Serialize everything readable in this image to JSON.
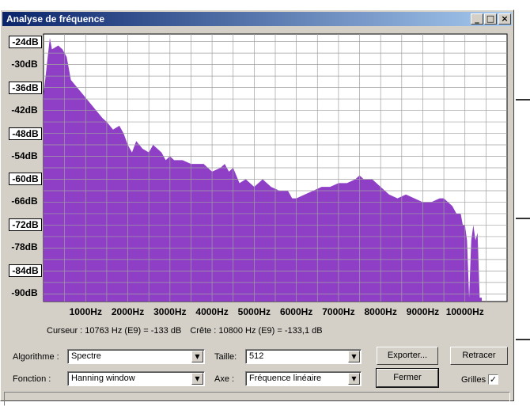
{
  "window": {
    "title": "Analyse de fréquence"
  },
  "titlebar_buttons": {
    "minimize": "_",
    "maximize": "□",
    "close": "×"
  },
  "chart_data": {
    "type": "area",
    "color": "#8e3fc6",
    "grid": true,
    "x_unit": "Hz",
    "y_unit": "dB",
    "xlim": [
      0,
      11000
    ],
    "ylim": [
      -92,
      -22
    ],
    "x_ticks": [
      "1000Hz",
      "2000Hz",
      "3000Hz",
      "4000Hz",
      "5000Hz",
      "6000Hz",
      "7000Hz",
      "8000Hz",
      "9000Hz",
      "10000Hz"
    ],
    "y_ticks": [
      "-24dB",
      "-30dB",
      "-36dB",
      "-42dB",
      "-48dB",
      "-54dB",
      "-60dB",
      "-66dB",
      "-72dB",
      "-78dB",
      "-84dB",
      "-90dB"
    ],
    "x": [
      0,
      150,
      200,
      350,
      450,
      550,
      650,
      800,
      950,
      1100,
      1250,
      1400,
      1500,
      1650,
      1800,
      1900,
      2000,
      2050,
      2100,
      2200,
      2350,
      2500,
      2600,
      2800,
      2900,
      3000,
      3100,
      3300,
      3500,
      3800,
      4000,
      4200,
      4300,
      4400,
      4500,
      4650,
      4800,
      5000,
      5200,
      5400,
      5600,
      5800,
      5900,
      6000,
      6200,
      6400,
      6600,
      6800,
      7000,
      7200,
      7400,
      7500,
      7600,
      7800,
      8000,
      8200,
      8400,
      8600,
      8800,
      9000,
      9200,
      9400,
      9500,
      9700,
      9800,
      9900,
      9950,
      10000,
      10050,
      10100,
      10150,
      10200,
      10250,
      10300,
      10350,
      10400
    ],
    "y": [
      -38,
      -23,
      -26,
      -25,
      -26,
      -28,
      -34,
      -36,
      -38,
      -40,
      -42,
      -44,
      -45,
      -47,
      -46,
      -48,
      -51,
      -52,
      -53,
      -50,
      -52,
      -53,
      -51,
      -53,
      -55,
      -54,
      -55,
      -55,
      -56,
      -56,
      -58,
      -57,
      -56,
      -58,
      -57,
      -61,
      -60,
      -62,
      -60,
      -62,
      -63,
      -63,
      -65,
      -65,
      -64,
      -63,
      -62,
      -62,
      -61,
      -61,
      -60,
      -59,
      -60,
      -60,
      -62,
      -64,
      -65,
      -64,
      -65,
      -66,
      -66,
      -65,
      -65,
      -67,
      -69,
      -69,
      -72,
      -72,
      -76,
      -91,
      -76,
      -72,
      -76,
      -74,
      -91,
      -91
    ]
  },
  "status": {
    "cursor": "Curseur : 10763 Hz (E9) = -133 dB",
    "peak": "Crête : 10800 Hz (E9) = -133,1 dB"
  },
  "controls": {
    "algorithme": {
      "label": "Algorithme :",
      "value": "Spectre"
    },
    "fonction": {
      "label": "Fonction :",
      "value": "Hanning window"
    },
    "taille": {
      "label": "Taille:",
      "value": "512"
    },
    "axe": {
      "label": "Axe :",
      "value": "Fréquence linéaire"
    },
    "dropdown_arrow": "▼"
  },
  "buttons": {
    "exporter": "Exporter...",
    "retracer": "Retracer",
    "fermer": "Fermer"
  },
  "grilles": {
    "label": "Grilles",
    "checked": true,
    "mark": "✓"
  }
}
